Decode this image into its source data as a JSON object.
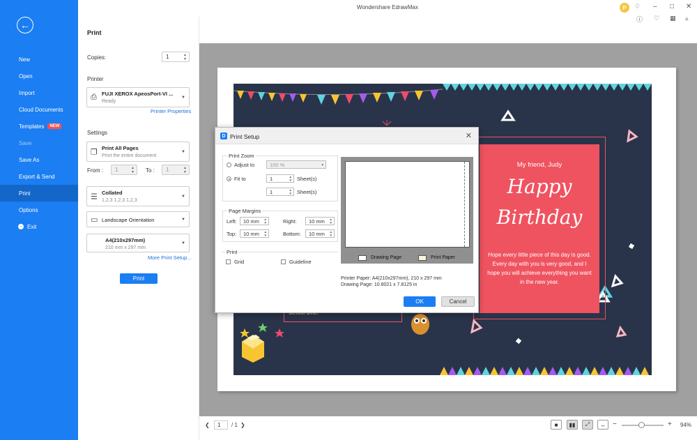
{
  "app": {
    "title": "Wondershare EdrawMax",
    "avatar_letter": "P"
  },
  "sidebar": {
    "items": [
      {
        "label": "New"
      },
      {
        "label": "Open"
      },
      {
        "label": "Import"
      },
      {
        "label": "Cloud Documents"
      },
      {
        "label": "Templates",
        "badge": "NEW"
      },
      {
        "label": "Save"
      },
      {
        "label": "Save As"
      },
      {
        "label": "Export & Send"
      },
      {
        "label": "Print"
      },
      {
        "label": "Options"
      },
      {
        "label": "Exit"
      }
    ]
  },
  "print": {
    "title": "Print",
    "copies_label": "Copies:",
    "copies_value": "1",
    "printer_label": "Printer",
    "printer_name": "FUJI XEROX ApeosPort-VI ...",
    "printer_status": "Ready",
    "printer_properties": "Printer Properties",
    "settings_label": "Settings",
    "range_main": "Print All Pages",
    "range_sub": "Print the entire document",
    "from_label": "From :",
    "from_value": "1",
    "to_label": "To :",
    "to_value": "1",
    "collate_main": "Collated",
    "collate_sub": "1,2,3 1,2,3 1,2,3",
    "orientation": "Landscape Orientation",
    "paper_main": "A4(210x297mm)",
    "paper_sub": "210 mm x 297 mm",
    "more_setup": "More Print Setup...",
    "print_button": "Print"
  },
  "card": {
    "friend": "My friend, Judy",
    "happy": "Happy",
    "birthday": "Birthday",
    "message_1": "Hope every little piece of this day is good.",
    "message_2": "Every day with you is very good, and I hope you will achieve everything you want in the new year.",
    "school": "school time!"
  },
  "bottom": {
    "page_current": "1",
    "page_total": "/ 1",
    "zoom": "94%"
  },
  "dialog": {
    "title": "Print Setup",
    "zoom_group": "Print Zoom",
    "adjust_to": "Adjust to",
    "adjust_value": "100 %",
    "fit_to": "Fit to",
    "fit_w": "1",
    "fit_h": "1",
    "sheets": "Sheet(s)",
    "margins_group": "Page Margins",
    "left_label": "Left:",
    "left_value": "10 mm",
    "right_label": "Right:",
    "right_value": "10 mm",
    "top_label": "Top:",
    "top_value": "10 mm",
    "bottom_label": "Bottom:",
    "bottom_value": "10 mm",
    "print_group": "Print",
    "grid": "Grid",
    "guideline": "Guideline",
    "legend_drawing": "Drawing Page",
    "legend_paper": "Print Paper",
    "printer_paper": "Printer Paper: A4(210x297mm), 210 x 297 mm",
    "drawing_page": "Drawing Page: 10.8021 x 7.8125 in",
    "ok": "OK",
    "cancel": "Cancel"
  }
}
